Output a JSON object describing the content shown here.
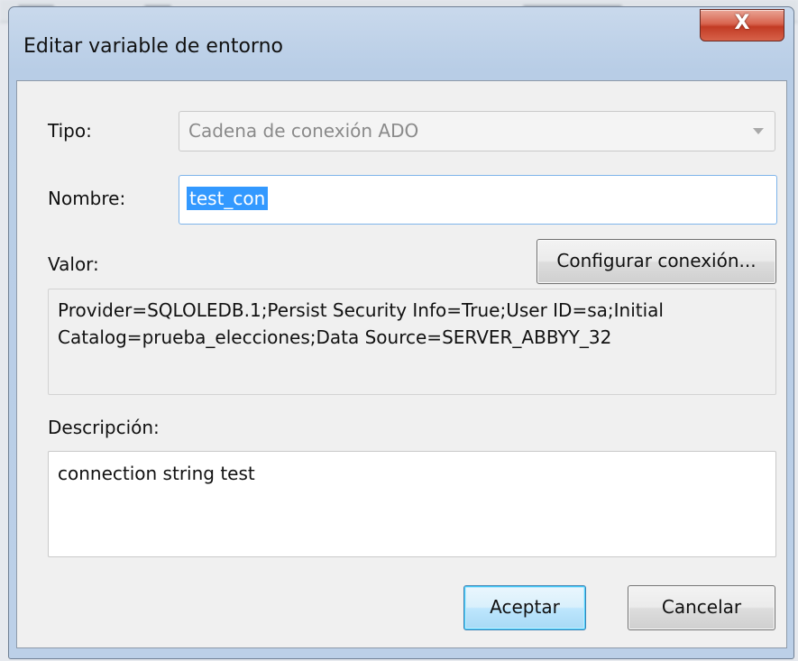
{
  "dialog": {
    "title": "Editar variable de entorno",
    "close_glyph": "X"
  },
  "form": {
    "tipo_label": "Tipo:",
    "tipo_value": "Cadena de conexión ADO",
    "nombre_label": "Nombre:",
    "nombre_value": "test_con",
    "valor_label": "Valor:",
    "configurar_button": "Configurar conexión...",
    "valor_text_line1": "Provider=SQLOLEDB.1;Persist Security Info=True;User ID=sa;Initial",
    "valor_text_line2": "Catalog=prueba_elecciones;Data Source=SERVER_ABBYY_32",
    "descripcion_label": "Descripción:",
    "descripcion_value": "connection string test"
  },
  "buttons": {
    "aceptar": "Aceptar",
    "cancelar": "Cancelar"
  },
  "icons": {
    "close": "close-icon",
    "dropdown": "chevron-down-icon"
  },
  "colors": {
    "selection": "#3399ff",
    "close_button": "#c23b24",
    "frame": "#bcd0e8"
  }
}
